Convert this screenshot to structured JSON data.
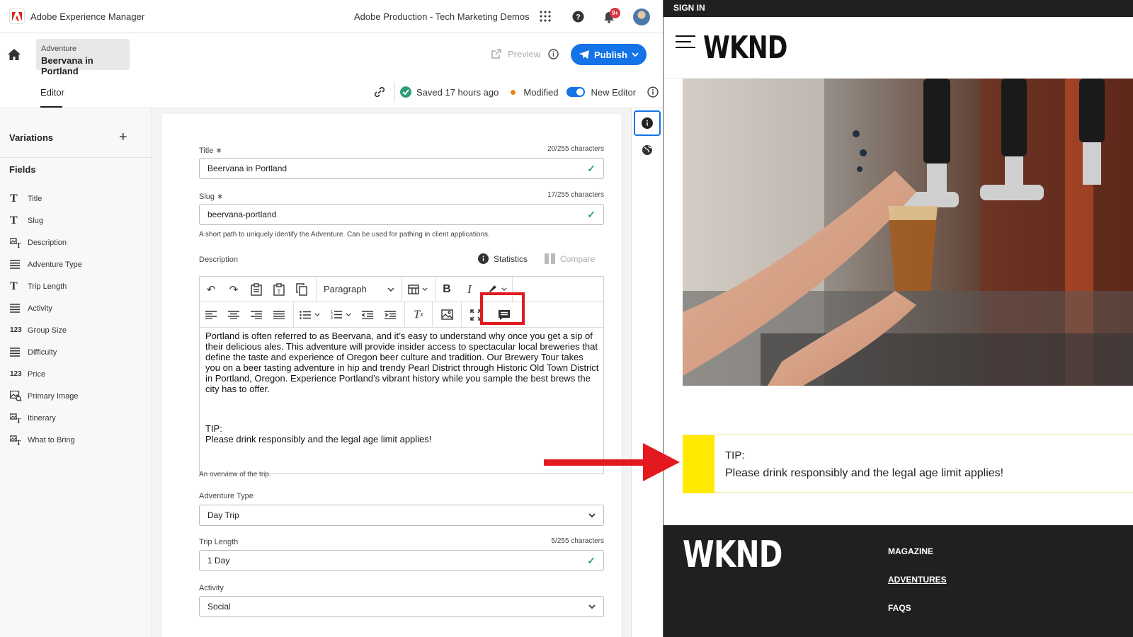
{
  "topbar": {
    "app_title": "Adobe Experience Manager",
    "org_name": "Adobe Production - Tech Marketing Demos",
    "notification_badge": "9+"
  },
  "breadcrumb": {
    "parent": "Adventure",
    "current": "Beervana in Portland"
  },
  "actions": {
    "preview_label": "Preview",
    "publish_label": "Publish"
  },
  "tabs": {
    "editor": "Editor"
  },
  "status": {
    "saved": "Saved 17 hours ago",
    "modified": "Modified",
    "new_editor": "New Editor"
  },
  "sidepanel": {
    "variations_title": "Variations",
    "fields_title": "Fields",
    "fields": [
      {
        "label": "Title",
        "icon": "T"
      },
      {
        "label": "Slug",
        "icon": "T"
      },
      {
        "label": "Description",
        "icon": "rte"
      },
      {
        "label": "Adventure Type",
        "icon": "list"
      },
      {
        "label": "Trip Length",
        "icon": "T"
      },
      {
        "label": "Activity",
        "icon": "list"
      },
      {
        "label": "Group Size",
        "icon": "123"
      },
      {
        "label": "Difficulty",
        "icon": "list"
      },
      {
        "label": "Price",
        "icon": "123"
      },
      {
        "label": "Primary Image",
        "icon": "image"
      },
      {
        "label": "Itinerary",
        "icon": "rte"
      },
      {
        "label": "What to Bring",
        "icon": "rte"
      }
    ]
  },
  "form": {
    "title": {
      "label": "Title",
      "count": "20/255 characters",
      "value": "Beervana in Portland"
    },
    "slug": {
      "label": "Slug",
      "count": "17/255 characters",
      "value": "beervana-portland",
      "help": "A short path to uniquely identify the Adventure. Can be used for pathing in client applications."
    },
    "description": {
      "label": "Description",
      "statistics": "Statistics",
      "compare": "Compare",
      "format": "Paragraph",
      "paragraph1": "Portland is often referred to as Beervana, and it’s easy to understand why once you get a sip of their delicious ales.  This adventure will provide insider access to spectacular local breweries that define the taste and experience of Oregon beer culture and tradition.   Our Brewery Tour takes you on a beer tasting adventure in hip and trendy Pearl District through Historic Old Town District in Portland, Oregon. Experience Portland’s vibrant history while you sample the best brews the city has to offer.",
      "tip_label": "TIP:",
      "tip_text": "Please drink responsibly and the legal age limit applies!",
      "help": "An overview of the trip."
    },
    "adventure_type": {
      "label": "Adventure Type",
      "value": "Day Trip"
    },
    "trip_length": {
      "label": "Trip Length",
      "count": "5/255 characters",
      "value": "1 Day"
    },
    "activity": {
      "label": "Activity",
      "value": "Social"
    }
  },
  "preview": {
    "sign_in": "SIGN IN",
    "logo": "WKND",
    "tip_label": "TIP:",
    "tip_text": "Please drink responsibly and the legal age limit applies!",
    "footer_nav": [
      "MAGAZINE",
      "ADVENTURES",
      "FAQS"
    ]
  },
  "colors": {
    "accent": "#1473e6",
    "highlight": "#e4191f",
    "tip_yellow": "#ffea00",
    "success": "#2d9d78",
    "modified": "#e68619"
  }
}
